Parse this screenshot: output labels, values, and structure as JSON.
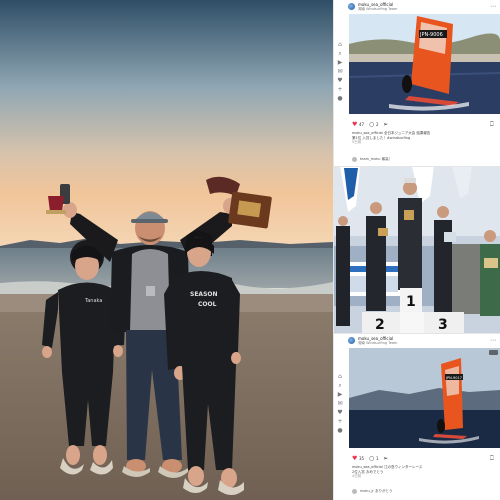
{
  "posts": [
    {
      "account": "moku_sea_official",
      "subtitle": "湘南 Windsurfing Team",
      "likes": "47",
      "comments": "2",
      "caption": [
        "moku_sea_official 全日本ジュニア大会 結果報告",
        "第1位 入賞しました！#windsurfing"
      ],
      "time": "5日前",
      "comment_line": "team_moku 最高！",
      "sail_label": "JPN-9006"
    },
    {
      "account": "moku_sea_official",
      "subtitle": "湘南 Windsurfing Team",
      "likes": "",
      "comments": "",
      "caption": [],
      "time": "",
      "comment_line": "",
      "podium_numbers": [
        "1",
        "2",
        "3"
      ]
    },
    {
      "account": "moku_sea_official",
      "subtitle": "湘南 Windsurfing Team",
      "likes": "35",
      "comments": "1",
      "caption": [
        "moku_sea_official 江の島ウィンターレース",
        "2位入賞 おめでとう"
      ],
      "time": "4日前",
      "comment_line": "moku_jr ありがとう",
      "sail_label": "JPN-9017"
    }
  ],
  "main_photo": {
    "wetsuit_left_text": "Tanaka",
    "wetsuit_right_text": [
      "SEASON",
      "COOL"
    ]
  },
  "icons": {
    "home": "⌂",
    "search": "⌕",
    "reels": "▶",
    "messages": "✉",
    "notifications": "♥",
    "create": "+",
    "profile": "●",
    "more": "⋯",
    "like": "♥",
    "comment": "○",
    "share": "➢",
    "bookmark": "⎕"
  },
  "colors": {
    "like_red": "#e8344e",
    "sail_orange": "#e8551f"
  }
}
